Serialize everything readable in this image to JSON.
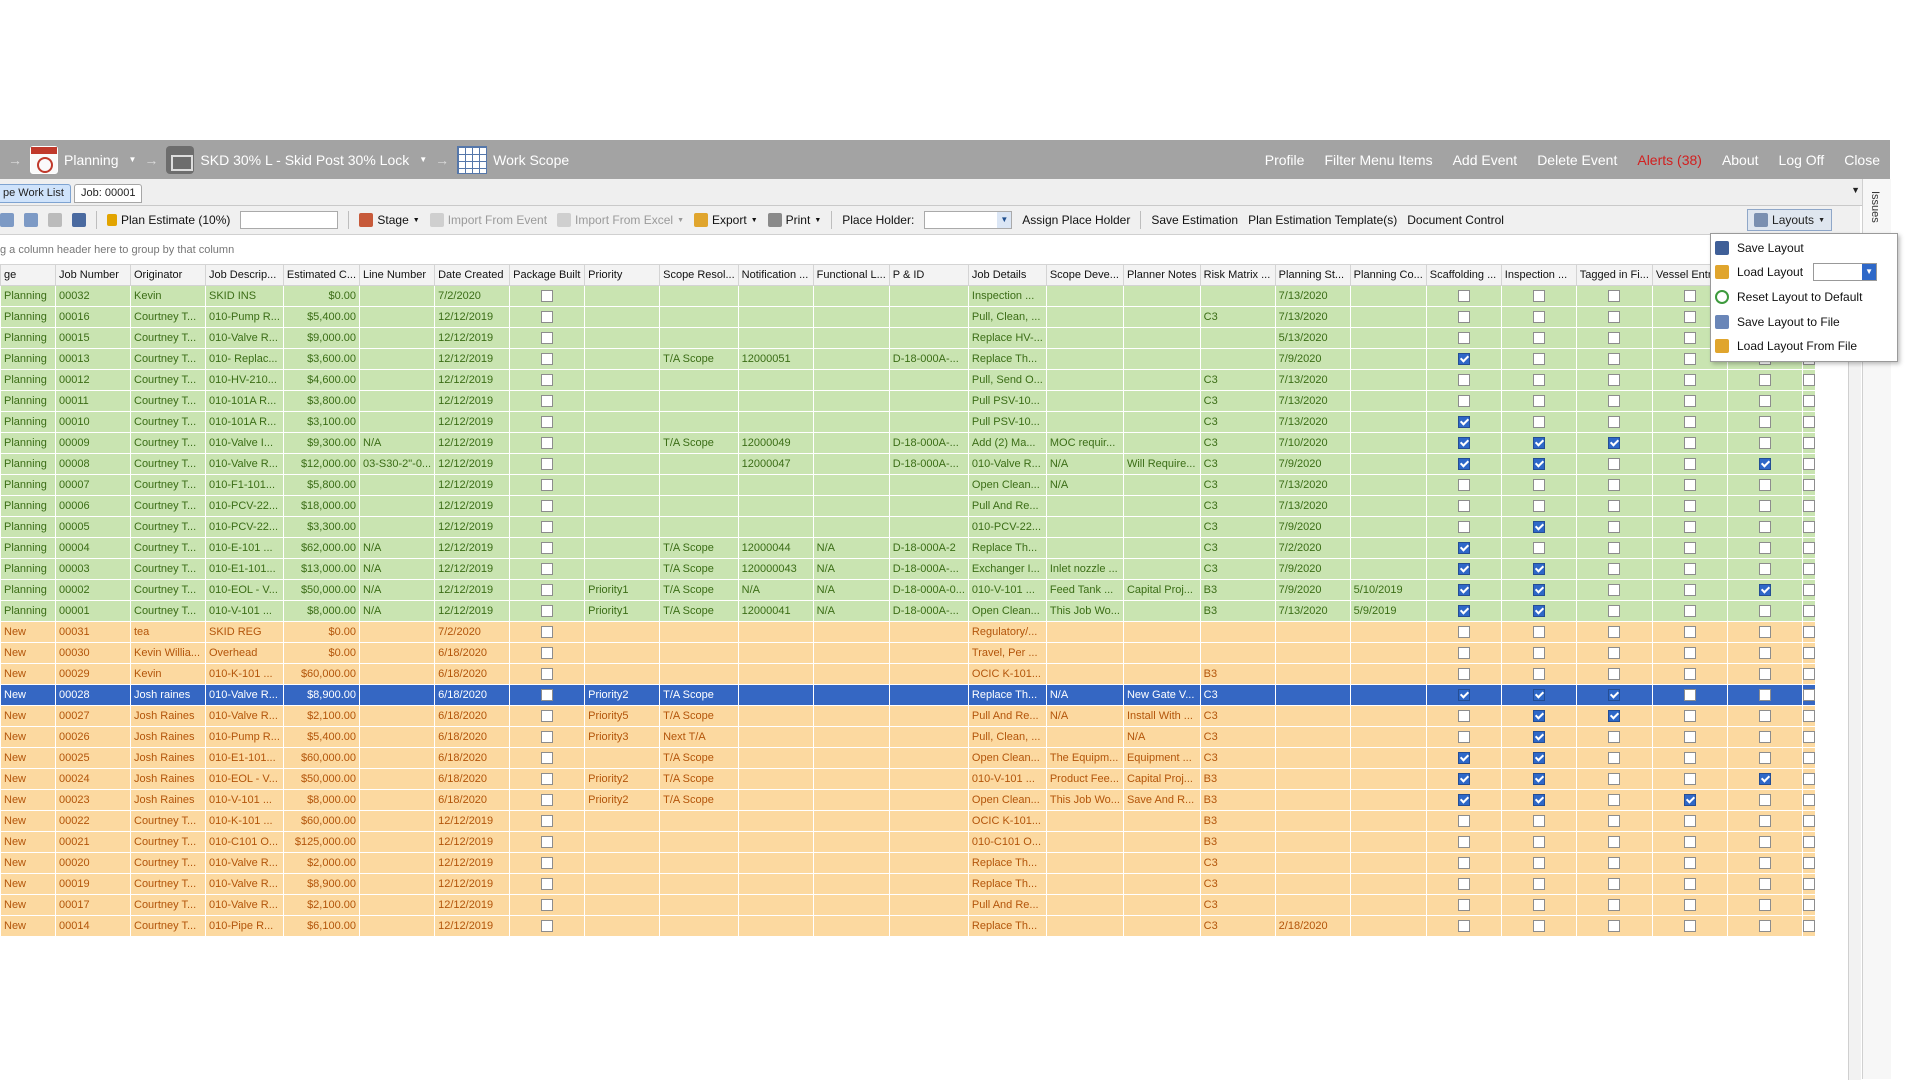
{
  "nav": {
    "crumbs": [
      {
        "label": "Planning",
        "icon": "calendar-icon"
      },
      {
        "label": "SKD 30% L -  Skid Post 30% Lock",
        "icon": "skid-icon"
      },
      {
        "label": "Work Scope",
        "icon": "worksheet-icon"
      }
    ],
    "links": [
      "Profile",
      "Filter Menu Items",
      "Add Event",
      "Delete Event",
      "Alerts (38)",
      "About",
      "Log Off",
      "Close"
    ],
    "alert_color": "#d21f1f"
  },
  "tabs": [
    "pe Work List",
    "Job: 00001"
  ],
  "toolbar": {
    "plan_estimate": "Plan Estimate (10%)",
    "stage": "Stage",
    "import_event": "Import From Event",
    "import_excel": "Import From Excel",
    "export": "Export",
    "print": "Print",
    "place_holder": "Place Holder:",
    "assign_place_holder": "Assign Place Holder",
    "save_estimation": "Save Estimation",
    "plan_templates": "Plan Estimation Template(s)",
    "document_control": "Document Control",
    "layouts": "Layouts"
  },
  "group_panel": "g a column header here to group by that column",
  "issues_label": "Issues",
  "layouts_menu": [
    "Save Layout",
    "Load Layout",
    "Reset Layout to Default",
    "Save Layout to File",
    "Load Layout From File"
  ],
  "columns": [
    "ge",
    "Job Number",
    "Originator",
    "Job Descrip...",
    "Estimated C...",
    "Line Number",
    "Date Created",
    "Package Built",
    "Priority",
    "Scope Resol...",
    "Notification ...",
    "Functional L...",
    "P & ID",
    "Job Details",
    "Scope Deve...",
    "Planner Notes",
    "Risk Matrix ...",
    "Planning St...",
    "Planning Co...",
    "Scaffolding ...",
    "Inspection ...",
    "Tagged in Fi...",
    "Vessel Entr...",
    "",
    ""
  ],
  "rows": [
    {
      "stage": "Planning",
      "job": "00032",
      "orig": "Kevin",
      "desc": "SKID INS",
      "cost": "$0.00",
      "line": "",
      "date": "7/2/2020",
      "priority": "",
      "scope": "",
      "notif": "",
      "func": "",
      "pid": "",
      "details": "Inspection ...",
      "scopedev": "",
      "notes": "",
      "risk": "",
      "pstart": "7/13/2020",
      "pcomp": "",
      "cb": [
        0,
        0,
        0,
        0,
        0,
        0
      ]
    },
    {
      "stage": "Planning",
      "job": "00016",
      "orig": "Courtney T...",
      "desc": "010-Pump R...",
      "cost": "$5,400.00",
      "line": "",
      "date": "12/12/2019",
      "priority": "",
      "scope": "",
      "notif": "",
      "func": "",
      "pid": "",
      "details": "Pull, Clean, ...",
      "scopedev": "",
      "notes": "",
      "risk": "C3",
      "pstart": "7/13/2020",
      "pcomp": "",
      "cb": [
        0,
        0,
        0,
        0,
        0,
        0
      ]
    },
    {
      "stage": "Planning",
      "job": "00015",
      "orig": "Courtney T...",
      "desc": "010-Valve R...",
      "cost": "$9,000.00",
      "line": "",
      "date": "12/12/2019",
      "priority": "",
      "scope": "",
      "notif": "",
      "func": "",
      "pid": "",
      "details": "Replace HV-...",
      "scopedev": "",
      "notes": "",
      "risk": "",
      "pstart": "5/13/2020",
      "pcomp": "",
      "cb": [
        0,
        0,
        0,
        0,
        0,
        0
      ]
    },
    {
      "stage": "Planning",
      "job": "00013",
      "orig": "Courtney T...",
      "desc": "010- Replac...",
      "cost": "$3,600.00",
      "line": "",
      "date": "12/12/2019",
      "priority": "",
      "scope": "T/A Scope",
      "notif": "12000051",
      "func": "",
      "pid": "D-18-000A-...",
      "details": "Replace Th...",
      "scopedev": "",
      "notes": "",
      "risk": "",
      "pstart": "7/9/2020",
      "pcomp": "",
      "cb": [
        1,
        0,
        0,
        0,
        0,
        0
      ]
    },
    {
      "stage": "Planning",
      "job": "00012",
      "orig": "Courtney T...",
      "desc": "010-HV-210...",
      "cost": "$4,600.00",
      "line": "",
      "date": "12/12/2019",
      "priority": "",
      "scope": "",
      "notif": "",
      "func": "",
      "pid": "",
      "details": "Pull, Send O...",
      "scopedev": "",
      "notes": "",
      "risk": "C3",
      "pstart": "7/13/2020",
      "pcomp": "",
      "cb": [
        0,
        0,
        0,
        0,
        0,
        0
      ]
    },
    {
      "stage": "Planning",
      "job": "00011",
      "orig": "Courtney T...",
      "desc": "010-101A R...",
      "cost": "$3,800.00",
      "line": "",
      "date": "12/12/2019",
      "priority": "",
      "scope": "",
      "notif": "",
      "func": "",
      "pid": "",
      "details": "Pull PSV-10...",
      "scopedev": "",
      "notes": "",
      "risk": "C3",
      "pstart": "7/13/2020",
      "pcomp": "",
      "cb": [
        0,
        0,
        0,
        0,
        0,
        0
      ]
    },
    {
      "stage": "Planning",
      "job": "00010",
      "orig": "Courtney T...",
      "desc": "010-101A R...",
      "cost": "$3,100.00",
      "line": "",
      "date": "12/12/2019",
      "priority": "",
      "scope": "",
      "notif": "",
      "func": "",
      "pid": "",
      "details": "Pull PSV-10...",
      "scopedev": "",
      "notes": "",
      "risk": "C3",
      "pstart": "7/13/2020",
      "pcomp": "",
      "cb": [
        1,
        0,
        0,
        0,
        0,
        0
      ]
    },
    {
      "stage": "Planning",
      "job": "00009",
      "orig": "Courtney T...",
      "desc": "010-Valve I...",
      "cost": "$9,300.00",
      "line": "N/A",
      "date": "12/12/2019",
      "priority": "",
      "scope": "T/A Scope",
      "notif": "12000049",
      "func": "",
      "pid": "D-18-000A-...",
      "details": "Add (2) Ma...",
      "scopedev": "MOC requir...",
      "notes": "",
      "risk": "C3",
      "pstart": "7/10/2020",
      "pcomp": "",
      "cb": [
        1,
        1,
        1,
        0,
        0,
        0
      ]
    },
    {
      "stage": "Planning",
      "job": "00008",
      "orig": "Courtney T...",
      "desc": "010-Valve R...",
      "cost": "$12,000.00",
      "line": "03-S30-2\"-0...",
      "date": "12/12/2019",
      "priority": "",
      "scope": "",
      "notif": "12000047",
      "func": "",
      "pid": "D-18-000A-...",
      "details": "010-Valve R...",
      "scopedev": "N/A",
      "notes": "Will Require...",
      "risk": "C3",
      "pstart": "7/9/2020",
      "pcomp": "",
      "cb": [
        1,
        1,
        0,
        0,
        1,
        0
      ]
    },
    {
      "stage": "Planning",
      "job": "00007",
      "orig": "Courtney T...",
      "desc": "010-F1-101...",
      "cost": "$5,800.00",
      "line": "",
      "date": "12/12/2019",
      "priority": "",
      "scope": "",
      "notif": "",
      "func": "",
      "pid": "",
      "details": "Open Clean...",
      "scopedev": "N/A",
      "notes": "",
      "risk": "C3",
      "pstart": "7/13/2020",
      "pcomp": "",
      "cb": [
        0,
        0,
        0,
        0,
        0,
        0
      ]
    },
    {
      "stage": "Planning",
      "job": "00006",
      "orig": "Courtney T...",
      "desc": "010-PCV-22...",
      "cost": "$18,000.00",
      "line": "",
      "date": "12/12/2019",
      "priority": "",
      "scope": "",
      "notif": "",
      "func": "",
      "pid": "",
      "details": "Pull And Re...",
      "scopedev": "",
      "notes": "",
      "risk": "C3",
      "pstart": "7/13/2020",
      "pcomp": "",
      "cb": [
        0,
        0,
        0,
        0,
        0,
        0
      ]
    },
    {
      "stage": "Planning",
      "job": "00005",
      "orig": "Courtney T...",
      "desc": "010-PCV-22...",
      "cost": "$3,300.00",
      "line": "",
      "date": "12/12/2019",
      "priority": "",
      "scope": "",
      "notif": "",
      "func": "",
      "pid": "",
      "details": "010-PCV-22...",
      "scopedev": "",
      "notes": "",
      "risk": "C3",
      "pstart": "7/9/2020",
      "pcomp": "",
      "cb": [
        0,
        1,
        0,
        0,
        0,
        0
      ]
    },
    {
      "stage": "Planning",
      "job": "00004",
      "orig": "Courtney T...",
      "desc": "010-E-101 ...",
      "cost": "$62,000.00",
      "line": "N/A",
      "date": "12/12/2019",
      "priority": "",
      "scope": "T/A Scope",
      "notif": "12000044",
      "func": "N/A",
      "pid": "D-18-000A-2",
      "details": "Replace Th...",
      "scopedev": "",
      "notes": "",
      "risk": "C3",
      "pstart": "7/2/2020",
      "pcomp": "",
      "cb": [
        1,
        0,
        0,
        0,
        0,
        0
      ]
    },
    {
      "stage": "Planning",
      "job": "00003",
      "orig": "Courtney T...",
      "desc": "010-E1-101...",
      "cost": "$13,000.00",
      "line": "N/A",
      "date": "12/12/2019",
      "priority": "",
      "scope": "T/A Scope",
      "notif": "120000043",
      "func": "N/A",
      "pid": "D-18-000A-...",
      "details": "Exchanger I...",
      "scopedev": "Inlet nozzle ...",
      "notes": "",
      "risk": "C3",
      "pstart": "7/9/2020",
      "pcomp": "",
      "cb": [
        1,
        1,
        0,
        0,
        0,
        0
      ]
    },
    {
      "stage": "Planning",
      "job": "00002",
      "orig": "Courtney T...",
      "desc": "010-EOL - V...",
      "cost": "$50,000.00",
      "line": "N/A",
      "date": "12/12/2019",
      "priority": "Priority1",
      "scope": "T/A Scope",
      "notif": "N/A",
      "func": "N/A",
      "pid": "D-18-000A-0...",
      "details": "010-V-101 ...",
      "scopedev": "Feed Tank ...",
      "notes": "Capital Proj...",
      "risk": "B3",
      "pstart": "7/9/2020",
      "pcomp": "5/10/2019",
      "cb": [
        1,
        1,
        0,
        0,
        1,
        0
      ]
    },
    {
      "stage": "Planning",
      "job": "00001",
      "orig": "Courtney T...",
      "desc": "010-V-101 ...",
      "cost": "$8,000.00",
      "line": "N/A",
      "date": "12/12/2019",
      "priority": "Priority1",
      "scope": "T/A Scope",
      "notif": "12000041",
      "func": "N/A",
      "pid": "D-18-000A-...",
      "details": "Open Clean...",
      "scopedev": "This Job Wo...",
      "notes": "",
      "risk": "B3",
      "pstart": "7/13/2020",
      "pcomp": "5/9/2019",
      "cb": [
        1,
        1,
        0,
        0,
        0,
        0
      ]
    },
    {
      "stage": "New",
      "job": "00031",
      "orig": "tea",
      "desc": "SKID REG",
      "cost": "$0.00",
      "line": "",
      "date": "7/2/2020",
      "priority": "",
      "scope": "",
      "notif": "",
      "func": "",
      "pid": "",
      "details": "Regulatory/...",
      "scopedev": "",
      "notes": "",
      "risk": "",
      "pstart": "",
      "pcomp": "",
      "cb": [
        0,
        0,
        0,
        0,
        0,
        0
      ]
    },
    {
      "stage": "New",
      "job": "00030",
      "orig": "Kevin Willia...",
      "desc": "Overhead",
      "cost": "$0.00",
      "line": "",
      "date": "6/18/2020",
      "priority": "",
      "scope": "",
      "notif": "",
      "func": "",
      "pid": "",
      "details": "Travel, Per ...",
      "scopedev": "",
      "notes": "",
      "risk": "",
      "pstart": "",
      "pcomp": "",
      "cb": [
        0,
        0,
        0,
        0,
        0,
        0
      ]
    },
    {
      "stage": "New",
      "job": "00029",
      "orig": "Kevin",
      "desc": "010-K-101 ...",
      "cost": "$60,000.00",
      "line": "",
      "date": "6/18/2020",
      "priority": "",
      "scope": "",
      "notif": "",
      "func": "",
      "pid": "",
      "details": "OCIC K-101...",
      "scopedev": "",
      "notes": "",
      "risk": "B3",
      "pstart": "",
      "pcomp": "",
      "cb": [
        0,
        0,
        0,
        0,
        0,
        0
      ]
    },
    {
      "stage": "New",
      "job": "00028",
      "orig": "Josh raines",
      "desc": "010-Valve R...",
      "cost": "$8,900.00",
      "line": "",
      "date": "6/18/2020",
      "priority": "Priority2",
      "scope": "T/A Scope",
      "notif": "",
      "func": "",
      "pid": "",
      "details": "Replace Th...",
      "scopedev": "N/A",
      "notes": "New Gate V...",
      "risk": "C3",
      "pstart": "",
      "pcomp": "",
      "selected": true,
      "cb": [
        1,
        1,
        1,
        0,
        0,
        0
      ]
    },
    {
      "stage": "New",
      "job": "00027",
      "orig": "Josh Raines",
      "desc": "010-Valve R...",
      "cost": "$2,100.00",
      "line": "",
      "date": "6/18/2020",
      "priority": "Priority5",
      "scope": "T/A Scope",
      "notif": "",
      "func": "",
      "pid": "",
      "details": "Pull And Re...",
      "scopedev": "N/A",
      "notes": "Install With ...",
      "risk": "C3",
      "pstart": "",
      "pcomp": "",
      "cb": [
        0,
        1,
        1,
        0,
        0,
        0
      ]
    },
    {
      "stage": "New",
      "job": "00026",
      "orig": "Josh Raines",
      "desc": "010-Pump R...",
      "cost": "$5,400.00",
      "line": "",
      "date": "6/18/2020",
      "priority": "Priority3",
      "scope": "Next T/A",
      "notif": "",
      "func": "",
      "pid": "",
      "details": "Pull, Clean, ...",
      "scopedev": "",
      "notes": "N/A",
      "risk": "C3",
      "pstart": "",
      "pcomp": "",
      "cb": [
        0,
        1,
        0,
        0,
        0,
        0
      ]
    },
    {
      "stage": "New",
      "job": "00025",
      "orig": "Josh Raines",
      "desc": "010-E1-101...",
      "cost": "$60,000.00",
      "line": "",
      "date": "6/18/2020",
      "priority": "",
      "scope": "T/A Scope",
      "notif": "",
      "func": "",
      "pid": "",
      "details": "Open Clean...",
      "scopedev": "The Equipm...",
      "notes": "Equipment ...",
      "risk": "C3",
      "pstart": "",
      "pcomp": "",
      "cb": [
        1,
        1,
        0,
        0,
        0,
        0
      ]
    },
    {
      "stage": "New",
      "job": "00024",
      "orig": "Josh Raines",
      "desc": "010-EOL - V...",
      "cost": "$50,000.00",
      "line": "",
      "date": "6/18/2020",
      "priority": "Priority2",
      "scope": "T/A Scope",
      "notif": "",
      "func": "",
      "pid": "",
      "details": "010-V-101 ...",
      "scopedev": "Product Fee...",
      "notes": "Capital Proj...",
      "risk": "B3",
      "pstart": "",
      "pcomp": "",
      "cb": [
        1,
        1,
        0,
        0,
        1,
        0
      ]
    },
    {
      "stage": "New",
      "job": "00023",
      "orig": "Josh Raines",
      "desc": "010-V-101 ...",
      "cost": "$8,000.00",
      "line": "",
      "date": "6/18/2020",
      "priority": "Priority2",
      "scope": "T/A Scope",
      "notif": "",
      "func": "",
      "pid": "",
      "details": "Open Clean...",
      "scopedev": "This Job Wo...",
      "notes": "Save And R...",
      "risk": "B3",
      "pstart": "",
      "pcomp": "",
      "cb": [
        1,
        1,
        0,
        1,
        0,
        0
      ]
    },
    {
      "stage": "New",
      "job": "00022",
      "orig": "Courtney T...",
      "desc": "010-K-101 ...",
      "cost": "$60,000.00",
      "line": "",
      "date": "12/12/2019",
      "priority": "",
      "scope": "",
      "notif": "",
      "func": "",
      "pid": "",
      "details": "OCIC K-101...",
      "scopedev": "",
      "notes": "",
      "risk": "B3",
      "pstart": "",
      "pcomp": "",
      "cb": [
        0,
        0,
        0,
        0,
        0,
        0
      ]
    },
    {
      "stage": "New",
      "job": "00021",
      "orig": "Courtney T...",
      "desc": "010-C101 O...",
      "cost": "$125,000.00",
      "line": "",
      "date": "12/12/2019",
      "priority": "",
      "scope": "",
      "notif": "",
      "func": "",
      "pid": "",
      "details": "010-C101 O...",
      "scopedev": "",
      "notes": "",
      "risk": "B3",
      "pstart": "",
      "pcomp": "",
      "cb": [
        0,
        0,
        0,
        0,
        0,
        0
      ]
    },
    {
      "stage": "New",
      "job": "00020",
      "orig": "Courtney T...",
      "desc": "010-Valve R...",
      "cost": "$2,000.00",
      "line": "",
      "date": "12/12/2019",
      "priority": "",
      "scope": "",
      "notif": "",
      "func": "",
      "pid": "",
      "details": "Replace Th...",
      "scopedev": "",
      "notes": "",
      "risk": "C3",
      "pstart": "",
      "pcomp": "",
      "cb": [
        0,
        0,
        0,
        0,
        0,
        0
      ]
    },
    {
      "stage": "New",
      "job": "00019",
      "orig": "Courtney T...",
      "desc": "010-Valve R...",
      "cost": "$8,900.00",
      "line": "",
      "date": "12/12/2019",
      "priority": "",
      "scope": "",
      "notif": "",
      "func": "",
      "pid": "",
      "details": "Replace Th...",
      "scopedev": "",
      "notes": "",
      "risk": "C3",
      "pstart": "",
      "pcomp": "",
      "cb": [
        0,
        0,
        0,
        0,
        0,
        0
      ]
    },
    {
      "stage": "New",
      "job": "00017",
      "orig": "Courtney T...",
      "desc": "010-Valve R...",
      "cost": "$2,100.00",
      "line": "",
      "date": "12/12/2019",
      "priority": "",
      "scope": "",
      "notif": "",
      "func": "",
      "pid": "",
      "details": "Pull And Re...",
      "scopedev": "",
      "notes": "",
      "risk": "C3",
      "pstart": "",
      "pcomp": "",
      "cb": [
        0,
        0,
        0,
        0,
        0,
        0
      ]
    },
    {
      "stage": "New",
      "job": "00014",
      "orig": "Courtney T...",
      "desc": "010-Pipe R...",
      "cost": "$6,100.00",
      "line": "",
      "date": "12/12/2019",
      "priority": "",
      "scope": "",
      "notif": "",
      "func": "",
      "pid": "",
      "details": "Replace Th...",
      "scopedev": "",
      "notes": "",
      "risk": "C3",
      "pstart": "2/18/2020",
      "pcomp": "",
      "cb": [
        0,
        0,
        0,
        0,
        0,
        0
      ]
    }
  ]
}
